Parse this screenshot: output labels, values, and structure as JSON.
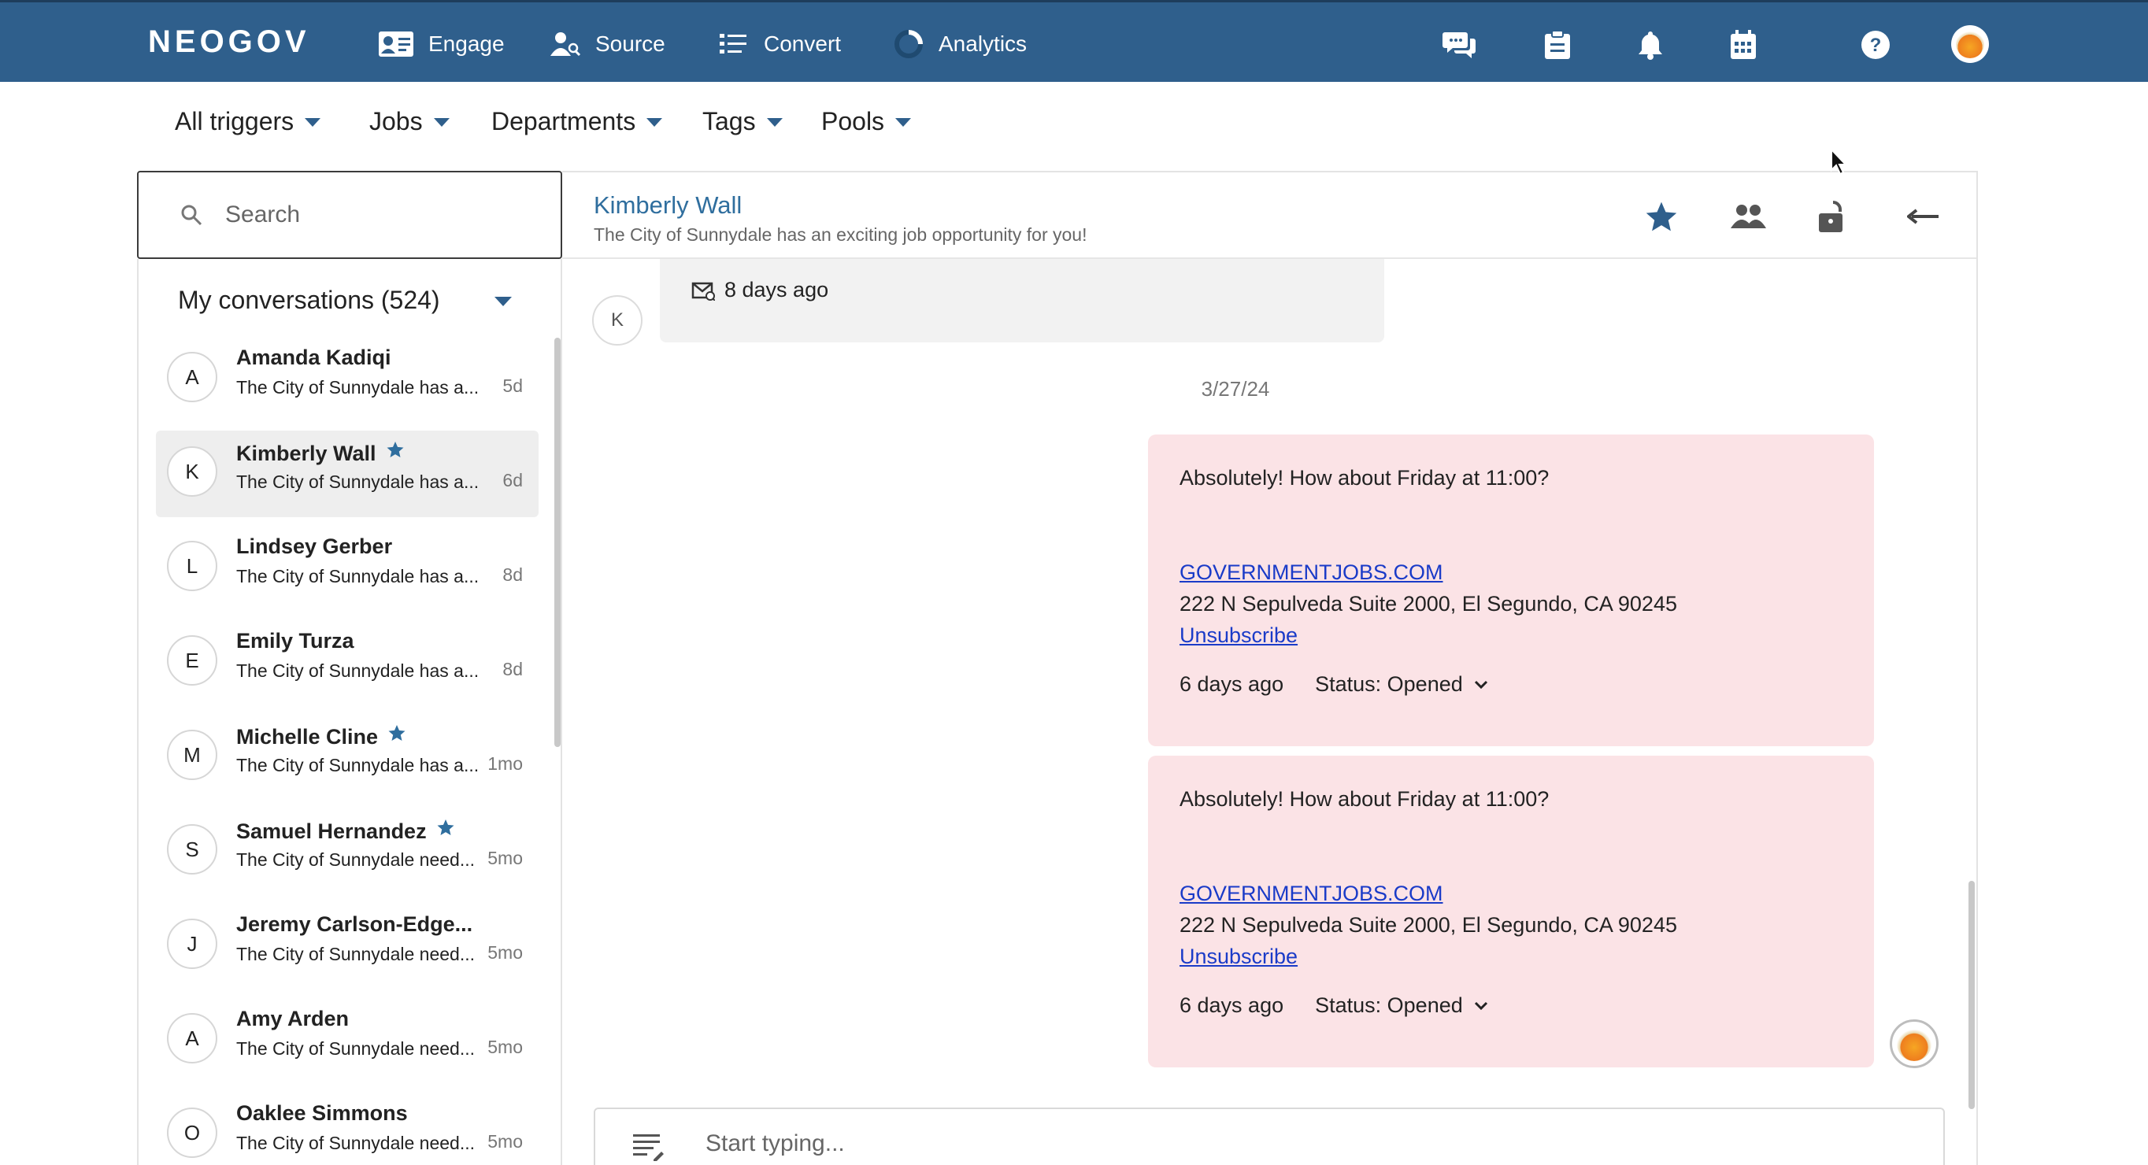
{
  "app": {
    "logo": "NEOGOV",
    "nav": [
      {
        "label": "Engage",
        "icon": "contact-card-icon"
      },
      {
        "label": "Source",
        "icon": "person-search-icon"
      },
      {
        "label": "Convert",
        "icon": "checklist-icon"
      },
      {
        "label": "Analytics",
        "icon": "analytics-ring-icon"
      }
    ],
    "top_icons": [
      "chat-bubbles-icon",
      "clipboard-icon",
      "bell-icon",
      "calendar-icon",
      "help-icon",
      "user-avatar"
    ]
  },
  "filters": [
    {
      "label": "All triggers"
    },
    {
      "label": "Jobs"
    },
    {
      "label": "Departments"
    },
    {
      "label": "Tags"
    },
    {
      "label": "Pools"
    }
  ],
  "search": {
    "placeholder": "Search",
    "value": ""
  },
  "conversations": {
    "header": "My conversations (524)",
    "items": [
      {
        "initial": "A",
        "name": "Amanda Kadiqi",
        "starred": false,
        "preview": "The City of Sunnydale has a...",
        "time": "5d",
        "active": false
      },
      {
        "initial": "K",
        "name": "Kimberly Wall",
        "starred": true,
        "preview": "The City of Sunnydale has a...",
        "time": "6d",
        "active": true
      },
      {
        "initial": "L",
        "name": "Lindsey Gerber",
        "starred": false,
        "preview": "The City of Sunnydale has a...",
        "time": "8d",
        "active": false
      },
      {
        "initial": "E",
        "name": "Emily Turza",
        "starred": false,
        "preview": "The City of Sunnydale has a...",
        "time": "8d",
        "active": false
      },
      {
        "initial": "M",
        "name": "Michelle Cline",
        "starred": true,
        "preview": "The City of Sunnydale has a...",
        "time": "1mo",
        "active": false
      },
      {
        "initial": "S",
        "name": "Samuel Hernandez",
        "starred": true,
        "preview": "The City of Sunnydale need...",
        "time": "5mo",
        "active": false
      },
      {
        "initial": "J",
        "name": "Jeremy Carlson-Edge...",
        "starred": false,
        "preview": "The City of Sunnydale need...",
        "time": "5mo",
        "active": false
      },
      {
        "initial": "A",
        "name": "Amy Arden",
        "starred": false,
        "preview": "The City of Sunnydale need...",
        "time": "5mo",
        "active": false
      },
      {
        "initial": "O",
        "name": "Oaklee Simmons",
        "starred": false,
        "preview": "The City of Sunnydale need...",
        "time": "5mo",
        "active": false
      }
    ]
  },
  "conversation": {
    "contact_name": "Kimberly Wall",
    "contact_subtitle": "The City of Sunnydale has an exciting job opportunity for you!",
    "header_icons": [
      "star-icon",
      "group-icon",
      "unlock-icon",
      "back-arrow-icon"
    ],
    "incoming": {
      "avatar_initial": "K",
      "time": "8 days ago"
    },
    "date_separator": "3/27/24",
    "messages": [
      {
        "text": "Absolutely! How about Friday at 11:00?",
        "link": "GOVERNMENTJOBS.COM",
        "address": "222 N Sepulveda Suite 2000, El Segundo, CA 90245",
        "unsubscribe": "Unsubscribe",
        "time": "6 days ago",
        "status": "Status: Opened"
      },
      {
        "text": "Absolutely! How about Friday at 11:00?",
        "link": "GOVERNMENTJOBS.COM",
        "address": "222 N Sepulveda Suite 2000, El Segundo, CA 90245",
        "unsubscribe": "Unsubscribe",
        "time": "6 days ago",
        "status": "Status: Opened"
      }
    ],
    "composer_placeholder": "Start typing..."
  },
  "colors": {
    "nav_bg": "#2f5f8c",
    "accent": "#2f6e9e",
    "outgoing_bubble": "#fbe3e6",
    "incoming_bubble": "#f2f2f2",
    "link": "#1a3bc8"
  }
}
